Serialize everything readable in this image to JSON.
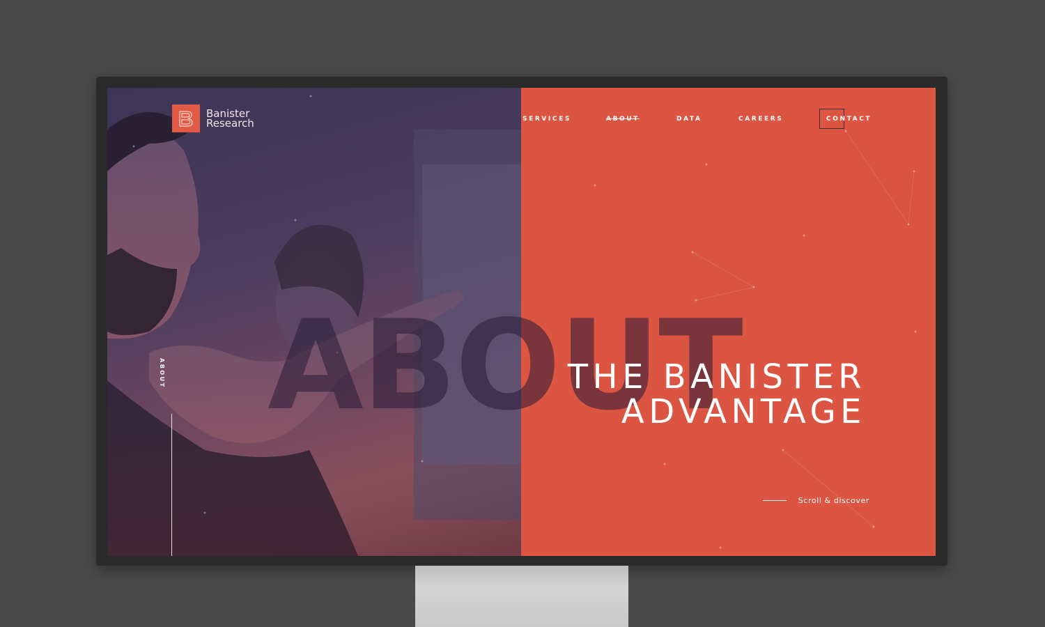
{
  "brand": {
    "name_line1": "Banister",
    "name_line2": "Research",
    "accent_color": "#db5542",
    "logo_icon": "b-monogram-icon"
  },
  "nav": {
    "items": [
      {
        "label": "SERVICES",
        "active": false
      },
      {
        "label": "ABOUT",
        "active": true
      },
      {
        "label": "DATA",
        "active": false
      },
      {
        "label": "CAREERS",
        "active": false
      },
      {
        "label": "CONTACT",
        "active": false
      }
    ]
  },
  "hero": {
    "background_word": "ABOUT",
    "headline_line1": "THE BANISTER",
    "headline_line2": "ADVANTAGE",
    "side_label": "ABOUT",
    "scroll_label": "Scroll & discover"
  }
}
